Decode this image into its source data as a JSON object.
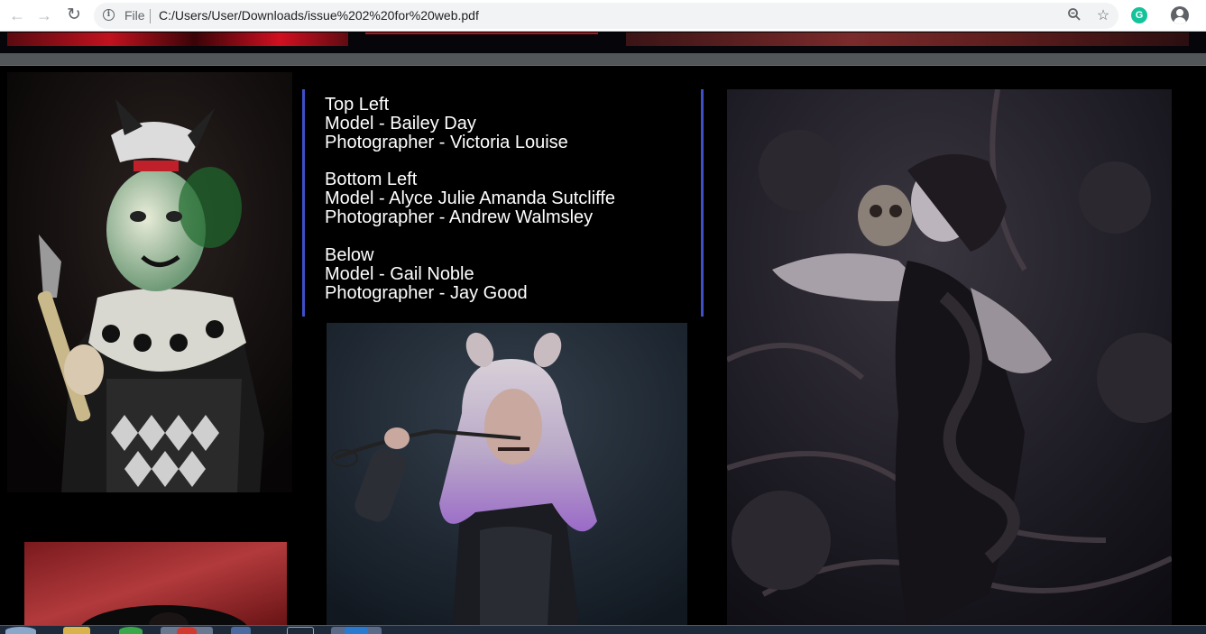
{
  "browser": {
    "back_icon": "arrow-left-icon",
    "forward_icon": "arrow-right-icon",
    "reload_icon": "reload-icon",
    "scheme_label": "File",
    "url": "C:/Users/User/Downloads/issue%202%20for%20web.pdf",
    "grammarly_letter": "G"
  },
  "credits": {
    "sections": [
      {
        "heading": "Top Left",
        "model": "Model - Bailey Day",
        "photographer": "Photographer - Victoria Louise"
      },
      {
        "heading": "Bottom Left",
        "model": "Model - Alyce Julie Amanda Sutcliffe",
        "photographer": "Photographer - Andrew Walmsley"
      },
      {
        "heading": "Below",
        "model": "Model - Gail Noble",
        "photographer": "Photographer - Jay Good"
      }
    ]
  },
  "colors": {
    "credit_border": "#3e4fc7",
    "page_background": "#000000",
    "grammarly": "#15c39a"
  }
}
